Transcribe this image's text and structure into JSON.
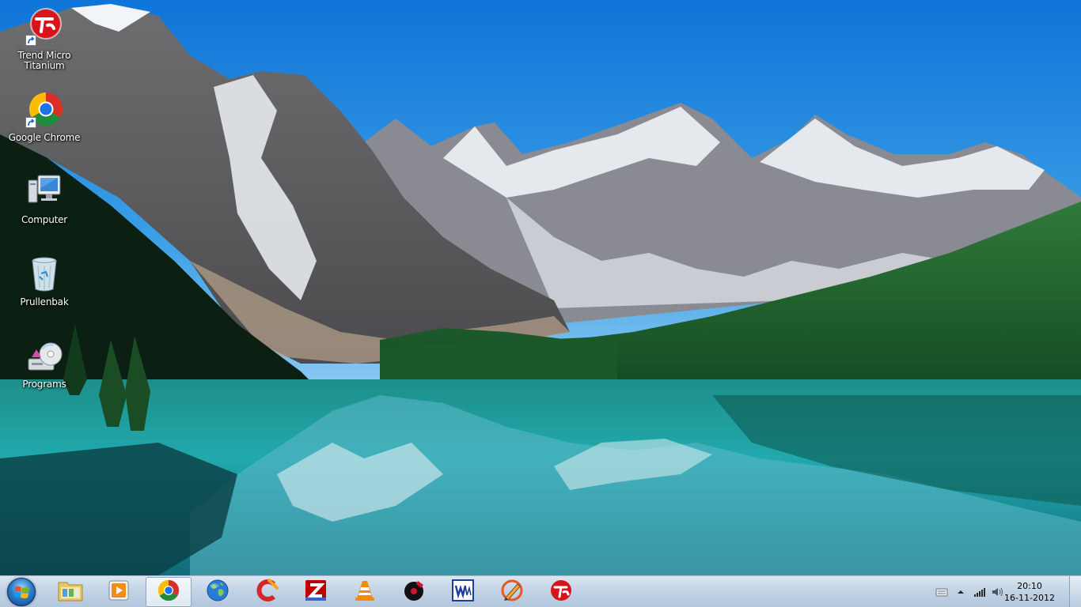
{
  "desktop": {
    "icons": [
      {
        "label": "Trend Micro Titanium",
        "icon": "trend-micro-icon"
      },
      {
        "label": "Google Chrome",
        "icon": "chrome-icon"
      },
      {
        "label": "Computer",
        "icon": "computer-icon"
      },
      {
        "label": "Prullenbak",
        "icon": "recycle-bin-icon"
      },
      {
        "label": "Programs",
        "icon": "programs-icon"
      }
    ]
  },
  "taskbar": {
    "pinned": [
      {
        "icon": "start-orb-icon"
      },
      {
        "icon": "file-explorer-icon"
      },
      {
        "icon": "media-player-icon"
      },
      {
        "icon": "chrome-icon",
        "active": true
      },
      {
        "icon": "globe-icon"
      },
      {
        "icon": "ccleaner-icon"
      },
      {
        "icon": "filezilla-icon"
      },
      {
        "icon": "vlc-icon"
      },
      {
        "icon": "music-player-icon"
      },
      {
        "icon": "word-icon"
      },
      {
        "icon": "pencil-app-icon"
      },
      {
        "icon": "trend-micro-icon"
      }
    ],
    "tray": {
      "icons": [
        "keyboard-icon",
        "show-hidden-icons-arrow",
        "network-signal-icon",
        "volume-icon"
      ],
      "time": "20:10",
      "date": "16-11-2012"
    }
  },
  "colors": {
    "sky": "#1f8fe0",
    "lake": "#1fa3a8",
    "forest": "#1e5f2c",
    "taskbar": "#c3d4e6"
  }
}
